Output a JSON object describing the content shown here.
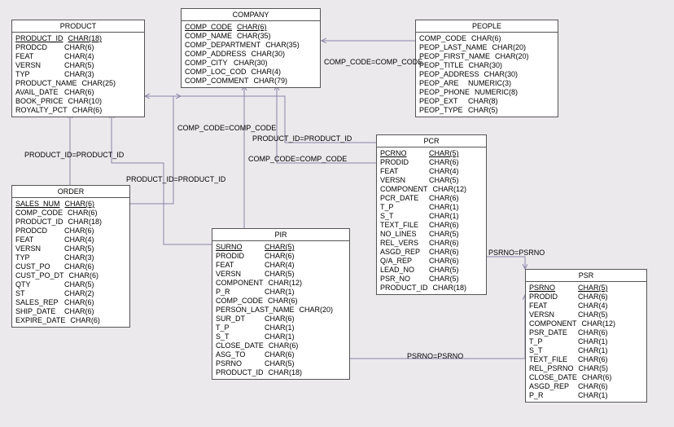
{
  "entities": {
    "product": {
      "title": "PRODUCT",
      "cols": [
        {
          "n": "PRODUCT_ID",
          "t": "CHAR(18)",
          "pk": true
        },
        {
          "n": "PRODCD",
          "t": "CHAR(6)"
        },
        {
          "n": "FEAT",
          "t": "CHAR(4)"
        },
        {
          "n": "VERSN",
          "t": "CHAR(5)"
        },
        {
          "n": "TYP",
          "t": "CHAR(3)"
        },
        {
          "n": "PRODUCT_NAME",
          "t": "CHAR(25)"
        },
        {
          "n": "AVAIL_DATE",
          "t": "CHAR(6)"
        },
        {
          "n": "BOOK_PRICE",
          "t": "CHAR(10)"
        },
        {
          "n": "ROYALTY_PCT",
          "t": "CHAR(6)"
        }
      ]
    },
    "company": {
      "title": "COMPANY",
      "cols": [
        {
          "n": "COMP_CODE",
          "t": "CHAR(6)",
          "pk": true
        },
        {
          "n": "COMP_NAME",
          "t": "CHAR(35)"
        },
        {
          "n": "COMP_DEPARTMENT",
          "t": "CHAR(35)"
        },
        {
          "n": "COMP_ADDRESS",
          "t": "CHAR(30)"
        },
        {
          "n": "COMP_CITY",
          "t": "CHAR(30)"
        },
        {
          "n": "COMP_LOC_COD",
          "t": "CHAR(4)"
        },
        {
          "n": "COMP_COMMENT",
          "t": "CHAR(79)"
        }
      ]
    },
    "people": {
      "title": "PEOPLE",
      "cols": [
        {
          "n": "COMP_CODE",
          "t": "CHAR(6)"
        },
        {
          "n": "PEOP_LAST_NAME",
          "t": "CHAR(20)"
        },
        {
          "n": "PEOP_FIRST_NAME",
          "t": "CHAR(20)"
        },
        {
          "n": "PEOP_TITLE",
          "t": "CHAR(30)"
        },
        {
          "n": "PEOP_ADDRESS",
          "t": "CHAR(30)"
        },
        {
          "n": "PEOP_ARE",
          "t": "NUMERIC(3)"
        },
        {
          "n": "PEOP_PHONE",
          "t": "NUMERIC(8)"
        },
        {
          "n": "PEOP_EXT",
          "t": "CHAR(8)"
        },
        {
          "n": "PEOP_TYPE",
          "t": "CHAR(5)"
        }
      ]
    },
    "order": {
      "title": "ORDER",
      "cols": [
        {
          "n": "SALES_NUM",
          "t": "CHAR(6)",
          "pk": true
        },
        {
          "n": "COMP_CODE",
          "t": "CHAR(6)"
        },
        {
          "n": "PRODUCT_ID",
          "t": "CHAR(18)"
        },
        {
          "n": "PRODCD",
          "t": "CHAR(6)"
        },
        {
          "n": "FEAT",
          "t": "CHAR(4)"
        },
        {
          "n": "VERSN",
          "t": "CHAR(5)"
        },
        {
          "n": "TYP",
          "t": "CHAR(3)"
        },
        {
          "n": "CUST_PO",
          "t": "CHAR(6)"
        },
        {
          "n": "CUST_PO_DT",
          "t": "CHAR(6)"
        },
        {
          "n": "QTY",
          "t": "CHAR(5)"
        },
        {
          "n": "ST",
          "t": "CHAR(2)"
        },
        {
          "n": "SALES_REP",
          "t": "CHAR(6)"
        },
        {
          "n": "SHIP_DATE",
          "t": "CHAR(6)"
        },
        {
          "n": "EXPIRE_DATE",
          "t": "CHAR(6)"
        }
      ]
    },
    "pir": {
      "title": "PIR",
      "cols": [
        {
          "n": "SURNO",
          "t": "CHAR(5)",
          "pk": true
        },
        {
          "n": "PRODID",
          "t": "CHAR(6)"
        },
        {
          "n": "FEAT",
          "t": "CHAR(4)"
        },
        {
          "n": "VERSN",
          "t": "CHAR(5)"
        },
        {
          "n": "COMPONENT",
          "t": "CHAR(12)"
        },
        {
          "n": "P_R",
          "t": "CHAR(1)"
        },
        {
          "n": "COMP_CODE",
          "t": "CHAR(6)"
        },
        {
          "n": "PERSON_LAST_NAME",
          "t": "CHAR(20)"
        },
        {
          "n": "SUR_DT",
          "t": "CHAR(6)"
        },
        {
          "n": "T_P",
          "t": "CHAR(1)"
        },
        {
          "n": "S_T",
          "t": "CHAR(1)"
        },
        {
          "n": "CLOSE_DATE",
          "t": "CHAR(6)"
        },
        {
          "n": "ASG_TO",
          "t": "CHAR(6)"
        },
        {
          "n": "PSRNO",
          "t": "CHAR(5)"
        },
        {
          "n": "PRODUCT_ID",
          "t": "CHAR(18)"
        }
      ]
    },
    "pcr": {
      "title": "PCR",
      "cols": [
        {
          "n": "PCRNO",
          "t": "CHAR(5)",
          "pk": true
        },
        {
          "n": "PRODID",
          "t": "CHAR(6)"
        },
        {
          "n": "FEAT",
          "t": "CHAR(4)"
        },
        {
          "n": "VERSN",
          "t": "CHAR(5)"
        },
        {
          "n": "COMPONENT",
          "t": "CHAR(12)"
        },
        {
          "n": "PCR_DATE",
          "t": "CHAR(6)"
        },
        {
          "n": "T_P",
          "t": "CHAR(1)"
        },
        {
          "n": "S_T",
          "t": "CHAR(1)"
        },
        {
          "n": "TEXT_FILE",
          "t": "CHAR(6)"
        },
        {
          "n": "NO_LINES",
          "t": "CHAR(5)"
        },
        {
          "n": "REL_VERS",
          "t": "CHAR(6)"
        },
        {
          "n": "ASGD_REP",
          "t": "CHAR(6)"
        },
        {
          "n": "Q/A_REP",
          "t": "CHAR(6)"
        },
        {
          "n": "LEAD_NO",
          "t": "CHAR(5)"
        },
        {
          "n": "PSR_NO",
          "t": "CHAR(5)"
        },
        {
          "n": "PRODUCT_ID",
          "t": "CHAR(18)"
        }
      ]
    },
    "psr": {
      "title": "PSR",
      "cols": [
        {
          "n": "PSRNO",
          "t": "CHAR(5)",
          "pk": true
        },
        {
          "n": "PRODID",
          "t": "CHAR(6)"
        },
        {
          "n": "FEAT",
          "t": "CHAR(4)"
        },
        {
          "n": "VERSN",
          "t": "CHAR(5)"
        },
        {
          "n": "COMPONENT",
          "t": "CHAR(12)"
        },
        {
          "n": "PSR_DATE",
          "t": "CHAR(6)"
        },
        {
          "n": "T_P",
          "t": "CHAR(1)"
        },
        {
          "n": "S_T",
          "t": "CHAR(1)"
        },
        {
          "n": "TEXT_FILE",
          "t": "CHAR(6)"
        },
        {
          "n": "REL_PSRNO",
          "t": "CHAR(5)"
        },
        {
          "n": "CLOSE_DATE",
          "t": "CHAR(6)"
        },
        {
          "n": "ASGD_REP",
          "t": "CHAR(6)"
        },
        {
          "n": "P_R",
          "t": "CHAR(1)"
        }
      ]
    }
  },
  "relLabels": {
    "prod_id_1": "PRODUCT_ID=PRODUCT_ID",
    "prod_id_2": "PRODUCT_ID=PRODUCT_ID",
    "prod_id_3": "PRODUCT_ID=PRODUCT_ID",
    "comp_code_1": "COMP_CODE=COMP_CODE",
    "comp_code_2": "COMP_CODE=COMP_CODE",
    "comp_code_3": "COMP_CODE=COMP_CODE",
    "psrno_1": "PSRNO=PSRNO",
    "psrno_2": "PSRNO=PSRNO"
  }
}
